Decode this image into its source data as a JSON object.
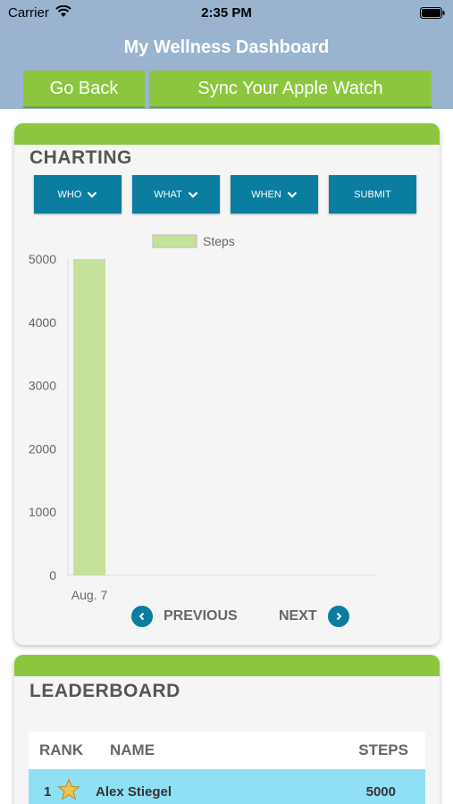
{
  "status_bar": {
    "carrier": "Carrier",
    "time": "2:35 PM"
  },
  "header": {
    "title": "My Wellness Dashboard"
  },
  "buttons": {
    "go_back": "Go Back",
    "sync": "Sync Your Apple Watch"
  },
  "charting": {
    "title": "CHARTING",
    "filters": {
      "who": "WHO",
      "what": "WHAT",
      "when": "WHEN",
      "submit": "SUBMIT"
    },
    "nav": {
      "previous": "PREVIOUS",
      "next": "NEXT"
    }
  },
  "chart_data": {
    "type": "bar",
    "categories": [
      "Aug. 7"
    ],
    "series": [
      {
        "name": "Steps",
        "values": [
          5000
        ],
        "color": "#c6e29a"
      }
    ],
    "ylim": [
      0,
      5000
    ],
    "yticks": [
      0,
      1000,
      2000,
      3000,
      4000,
      5000
    ],
    "xlabel": "",
    "ylabel": "",
    "legend": "top-center",
    "grid": false
  },
  "leaderboard": {
    "title": "LEADERBOARD",
    "columns": {
      "rank": "RANK",
      "name": "NAME",
      "steps": "STEPS"
    },
    "rows": [
      {
        "rank": "1",
        "name": "Alex Stiegel",
        "steps": "5000",
        "icon": "star-icon"
      }
    ]
  },
  "colors": {
    "header": "#9ab4d0",
    "accent_green": "#8cc63f",
    "button_blue": "#0b7da0",
    "row_highlight": "#8fe0f5"
  }
}
